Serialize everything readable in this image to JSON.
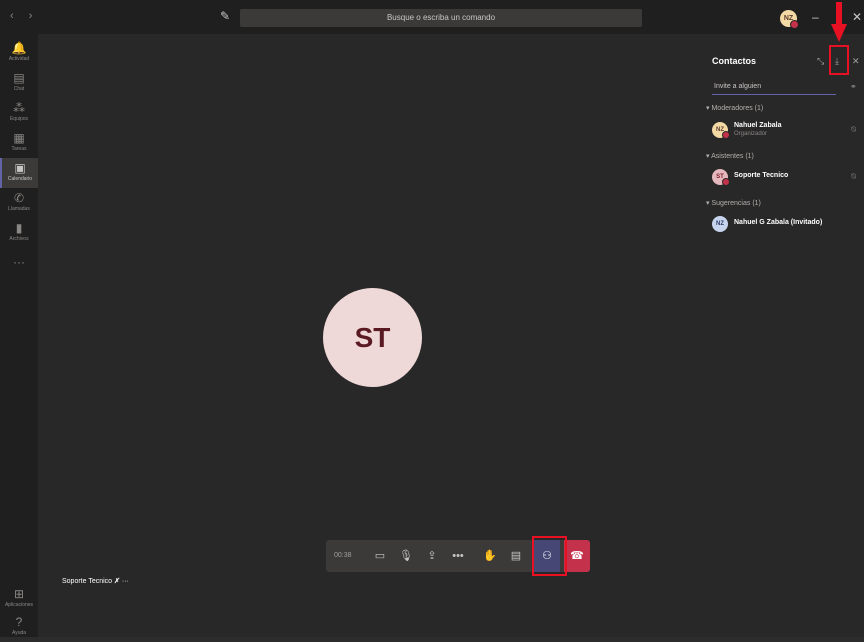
{
  "topbar": {
    "nav": "‹ ›",
    "search_placeholder": "Busque o escriba un comando",
    "avatar_initials": "NZ",
    "minimize": "–",
    "close": "✕"
  },
  "left_rail": {
    "items": [
      {
        "icon": "bell-icon",
        "label": "Actividad"
      },
      {
        "icon": "chat-icon",
        "label": "Chat"
      },
      {
        "icon": "teams-icon",
        "label": "Equipos"
      },
      {
        "icon": "tasks-icon",
        "label": "Tareas"
      },
      {
        "icon": "calendar-icon",
        "label": "Calendario"
      },
      {
        "icon": "phone-icon",
        "label": "Llamadas"
      },
      {
        "icon": "files-icon",
        "label": "Archivos"
      }
    ],
    "more": "···",
    "apps_label": "Aplicaciones",
    "help_label": "Ayuda"
  },
  "panel": {
    "title": "Contactos",
    "invite_placeholder": "Invite a alguien",
    "sections": [
      {
        "title": "Moderadores (1)"
      },
      {
        "title": "Asistentes (1)"
      },
      {
        "title": "Sugerencias (1)"
      }
    ],
    "people": [
      {
        "initials": "NZ",
        "name": "Nahuel Zabala",
        "role": "Organizador"
      },
      {
        "initials": "ST",
        "name": "Soporte Tecnico",
        "role": ""
      },
      {
        "initials": "NZ",
        "name": "Nahuel G Zabala (Invitado)",
        "role": ""
      }
    ]
  },
  "stage": {
    "big_avatar_initials": "ST",
    "participant_name": "Soporte Tecnico",
    "participant_more": "···"
  },
  "toolbar": {
    "timer": "00:38",
    "buttons": [
      "video-off-icon",
      "mic-off-icon",
      "share-icon",
      "more-icon",
      "raise-hand-icon",
      "chat-icon",
      "people-icon",
      "hangup-icon"
    ]
  },
  "colors": {
    "accent": "#6264a7",
    "hangup": "#c4314b",
    "highlight": "#e81123"
  }
}
